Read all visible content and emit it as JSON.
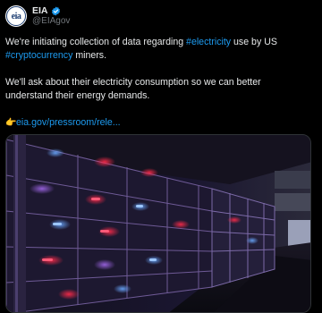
{
  "account": {
    "display_name": "EIA",
    "handle": "@EIAgov",
    "avatar_text": "eia",
    "verified": true
  },
  "tweet": {
    "line1_pre": "We're initiating collection of data regarding ",
    "hashtag_electricity": "#electricity",
    "line1_mid": " use by US ",
    "hashtag_crypto": "#cryptocurrency",
    "line1_post": " miners.",
    "para2": "We'll ask about their electricity consumption so we can better understand their energy demands.",
    "link_icon": "backhand-index-pointing-right-icon",
    "link_text": "eia.gov/pressroom/rele..."
  },
  "media": {
    "description_icon": "server-rack-photo",
    "colors": {
      "accent_purple": "#8a4fd1",
      "accent_red": "#ff2b4a",
      "accent_blue": "#5aa2ff"
    }
  },
  "colors": {
    "background": "#000000",
    "text": "#e7e9ea",
    "secondary": "#71767b",
    "link": "#1d9bf0",
    "verified": "#1d9bf0"
  }
}
